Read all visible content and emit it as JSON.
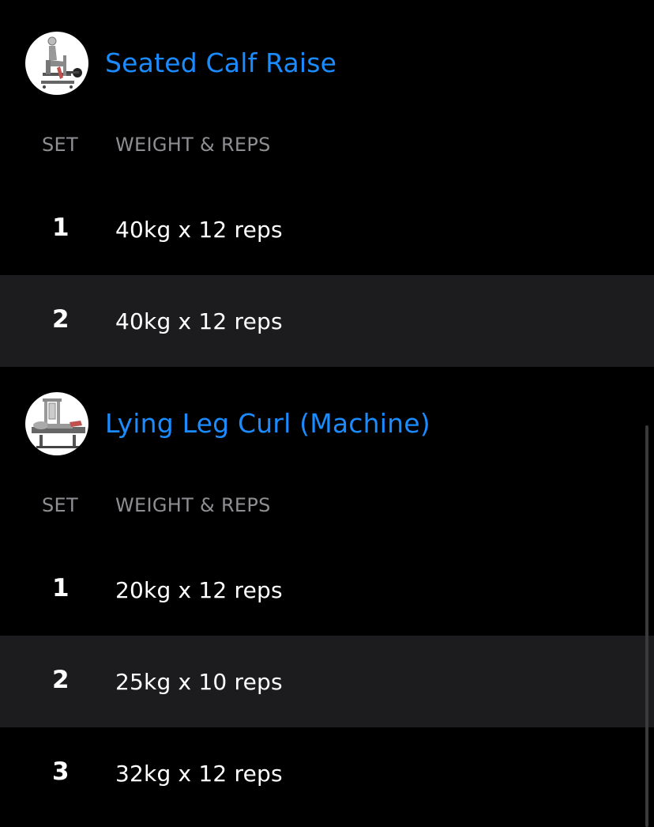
{
  "colors": {
    "accent": "#1a8cff",
    "background": "#000000",
    "alt_row": "#1c1c1e",
    "muted_text": "#8e8e93"
  },
  "exercises": [
    {
      "title": "Seated Calf Raise",
      "icon": "seated-calf-raise-thumbnail",
      "headers": {
        "set": "SET",
        "weight_reps": "WEIGHT & REPS"
      },
      "sets": [
        {
          "set": "1",
          "value": "40kg x 12 reps"
        },
        {
          "set": "2",
          "value": "40kg x 12 reps"
        }
      ]
    },
    {
      "title": "Lying Leg Curl (Machine)",
      "icon": "lying-leg-curl-thumbnail",
      "headers": {
        "set": "SET",
        "weight_reps": "WEIGHT & REPS"
      },
      "sets": [
        {
          "set": "1",
          "value": "20kg x 12 reps"
        },
        {
          "set": "2",
          "value": "25kg x 10 reps"
        },
        {
          "set": "3",
          "value": "32kg x 12 reps"
        }
      ]
    }
  ]
}
